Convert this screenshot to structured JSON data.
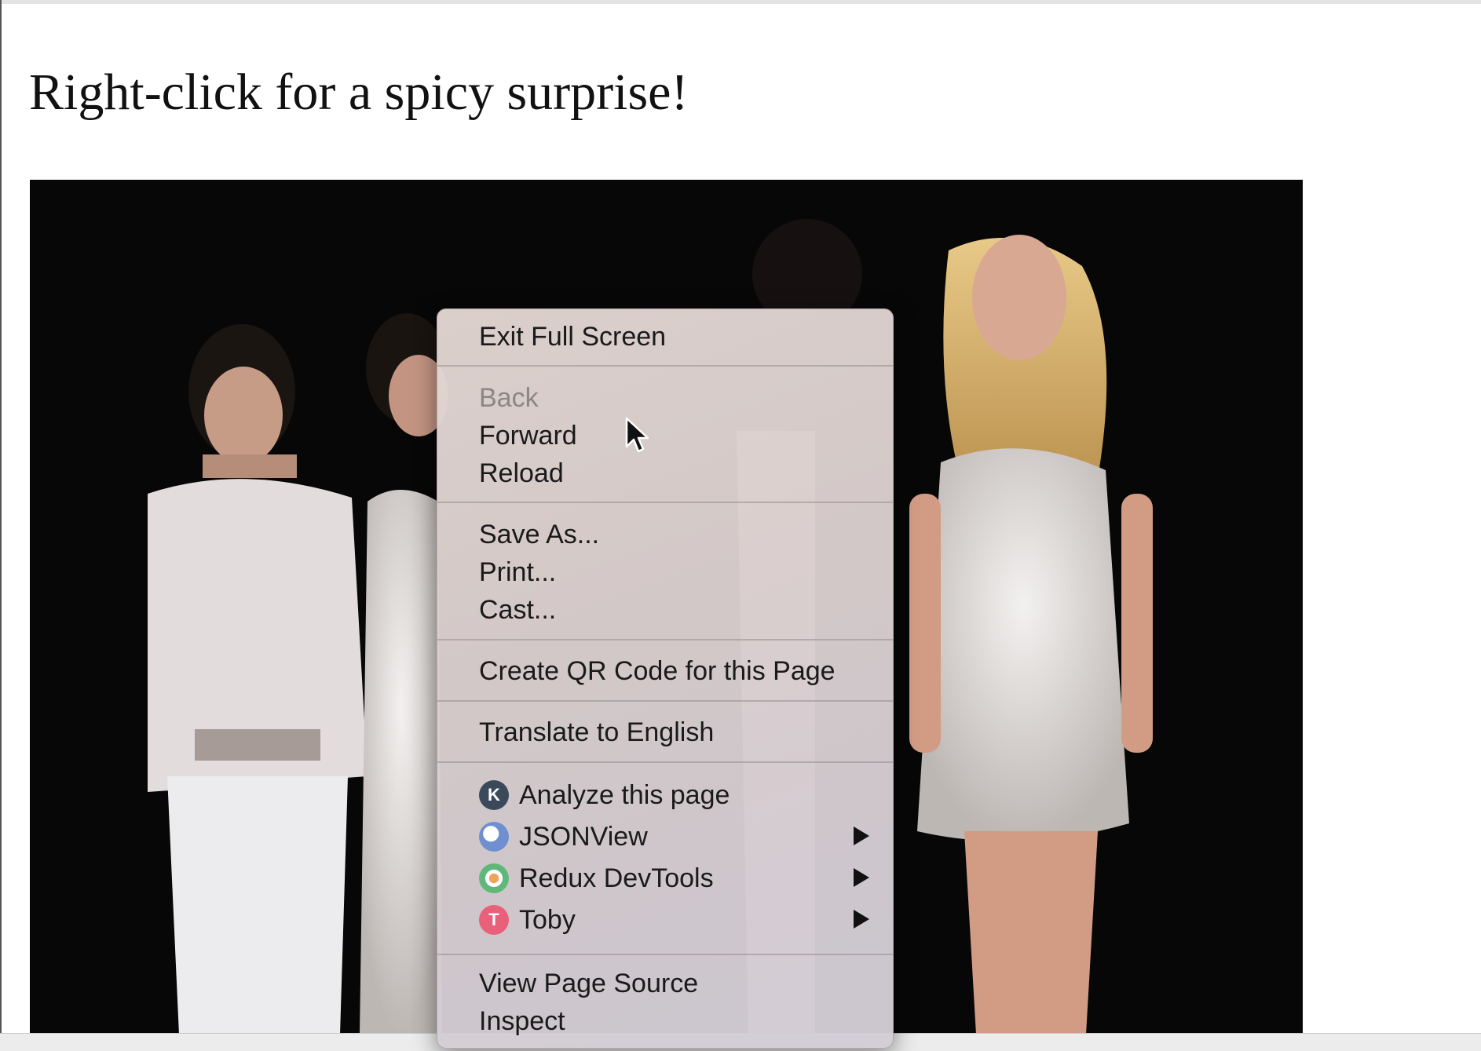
{
  "page": {
    "heading": "Right-click for a spicy surprise!"
  },
  "photo": {
    "kind": "concert-stage-photo"
  },
  "context_menu": {
    "groups": [
      {
        "items": [
          {
            "label": "Exit Full Screen",
            "enabled": true
          }
        ]
      },
      {
        "items": [
          {
            "label": "Back",
            "enabled": false
          },
          {
            "label": "Forward",
            "enabled": true
          },
          {
            "label": "Reload",
            "enabled": true
          }
        ]
      },
      {
        "items": [
          {
            "label": "Save As...",
            "enabled": true
          },
          {
            "label": "Print...",
            "enabled": true
          },
          {
            "label": "Cast...",
            "enabled": true
          }
        ]
      },
      {
        "items": [
          {
            "label": "Create QR Code for this Page",
            "enabled": true
          }
        ]
      },
      {
        "items": [
          {
            "label": "Translate to English",
            "enabled": true
          }
        ]
      },
      {
        "items": [
          {
            "label": "Analyze this page",
            "icon": "k-extension-icon",
            "icon_text": "K",
            "icon_color": "#3b4a5a",
            "submenu": false
          },
          {
            "label": "JSONView",
            "icon": "jsonview-icon",
            "icon_color": "#6f8fd0",
            "submenu": true
          },
          {
            "label": "Redux DevTools",
            "icon": "redux-devtools-icon",
            "icon_color": "#5fb87a",
            "submenu": true
          },
          {
            "label": "Toby",
            "icon": "toby-icon",
            "icon_text": "T",
            "icon_color": "#e8607a",
            "submenu": true
          }
        ]
      },
      {
        "items": [
          {
            "label": "View Page Source",
            "enabled": true
          },
          {
            "label": "Inspect",
            "enabled": true
          }
        ]
      }
    ]
  }
}
